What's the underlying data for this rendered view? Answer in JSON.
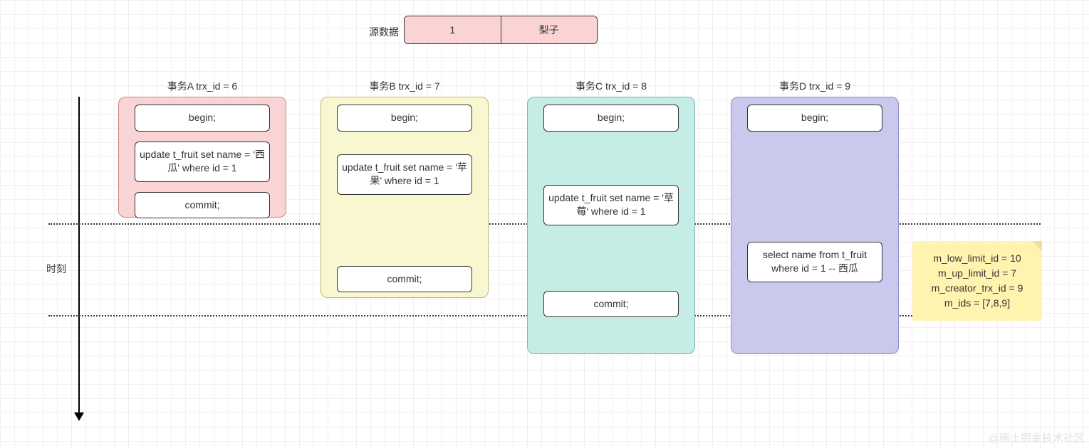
{
  "source": {
    "label": "源数据",
    "cells": {
      "id": "1",
      "name": "梨子"
    }
  },
  "timeline_label": "时刻",
  "trx": {
    "a": {
      "title": "事务A trx_id = 6",
      "begin": "begin;",
      "update": "update t_fruit set name = '西瓜' where id = 1",
      "commit": "commit;"
    },
    "b": {
      "title": "事务B trx_id = 7",
      "begin": "begin;",
      "update": "update t_fruit set name = '苹果' where id = 1",
      "commit": "commit;"
    },
    "c": {
      "title": "事务C trx_id = 8",
      "begin": "begin;",
      "update": "update t_fruit set name = '草莓' where id = 1",
      "commit": "commit;"
    },
    "d": {
      "title": "事务D trx_id = 9",
      "begin": "begin;",
      "select": "select name from t_fruit where id = 1 -- 西瓜"
    }
  },
  "note": {
    "l1": "m_low_limit_id = 10",
    "l2": "m_up_limit_id = 7",
    "l3": "m_creator_trx_id = 9",
    "l4": "m_ids = [7,8,9]"
  },
  "watermark": "@稀土掘金技术社区"
}
